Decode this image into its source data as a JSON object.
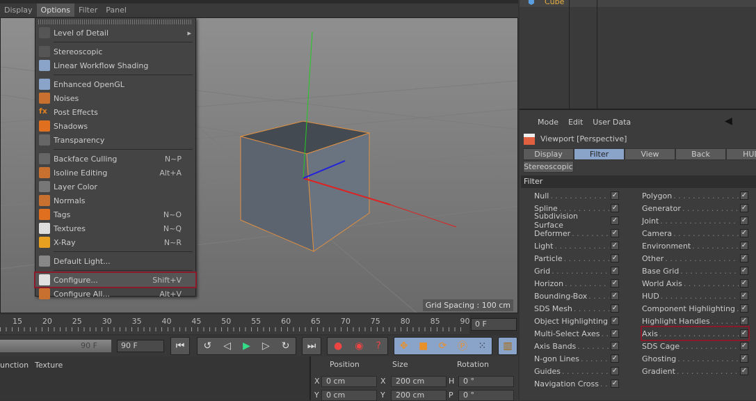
{
  "menubar": [
    "Display",
    "Options",
    "Filter",
    "Panel"
  ],
  "menu": {
    "items": [
      {
        "label": "Level of Detail",
        "submenu": true,
        "icon": "blank",
        "sep_after": true
      },
      {
        "label": "Stereoscopic",
        "icon": "glasses"
      },
      {
        "label": "Linear Workflow Shading",
        "icon": "curve",
        "sep_after": true
      },
      {
        "label": "Enhanced OpenGL",
        "icon": "opengl"
      },
      {
        "label": "Noises",
        "icon": "noise"
      },
      {
        "label": "Post Effects",
        "icon": "fx"
      },
      {
        "label": "Shadows",
        "icon": "shadow"
      },
      {
        "label": "Transparency",
        "icon": "cube",
        "sep_after": true
      },
      {
        "label": "Backface Culling",
        "shortcut": "N~P",
        "icon": "cube"
      },
      {
        "label": "Isoline Editing",
        "shortcut": "Alt+A",
        "icon": "isoline"
      },
      {
        "label": "Layer Color",
        "icon": "layer"
      },
      {
        "label": "Normals",
        "icon": "normals"
      },
      {
        "label": "Tags",
        "shortcut": "N~O",
        "icon": "eye"
      },
      {
        "label": "Textures",
        "shortcut": "N~Q",
        "icon": "checker"
      },
      {
        "label": "X-Ray",
        "shortcut": "N~R",
        "icon": "xray",
        "sep_after": true
      },
      {
        "label": "Default Light...",
        "icon": "light",
        "sep_after": true
      },
      {
        "label": "Configure...",
        "shortcut": "Shift+V",
        "icon": "configure",
        "highlight": true
      },
      {
        "label": "Configure All...",
        "shortcut": "Alt+V",
        "icon": "configure-all"
      }
    ]
  },
  "viewport": {
    "grid_spacing": "Grid Spacing : 100 cm"
  },
  "timeline": {
    "ticks": [
      "15",
      "20",
      "25",
      "30",
      "35",
      "40",
      "45",
      "50",
      "55",
      "60",
      "65",
      "70",
      "75",
      "80",
      "85",
      "90"
    ],
    "current_frame": "0 F",
    "end_frame": "90 F",
    "end_frame_field": "90 F"
  },
  "lower": {
    "tabs": [
      "unction",
      "Texture"
    ],
    "coords": {
      "headers": [
        "Position",
        "Size",
        "Rotation"
      ],
      "rows": [
        [
          "X",
          "0 cm",
          "X",
          "200 cm",
          "H",
          "0 °"
        ],
        [
          "Y",
          "0 cm",
          "Y",
          "200 cm",
          "P",
          "0 °"
        ]
      ]
    }
  },
  "object_manager": {
    "object": "Cube"
  },
  "attributes": {
    "menu": [
      "Mode",
      "Edit",
      "User Data"
    ],
    "title": "Viewport [Perspective]",
    "tabs": [
      "Display",
      "Filter",
      "View",
      "Back",
      "HUD"
    ],
    "active_tab": "Filter",
    "subtab": "Stereoscopic",
    "section": "Filter",
    "left": [
      "Null",
      "Spline",
      "Subdivision Surface",
      "Deformer",
      "Light",
      "Particle",
      "Grid",
      "Horizon",
      "Bounding-Box",
      "SDS Mesh",
      "Object Highlighting",
      "Multi-Select Axes",
      "Axis Bands",
      "N-gon Lines",
      "Guides",
      "Navigation Cross"
    ],
    "right": [
      "Polygon",
      "Generator",
      "Joint",
      "Camera",
      "Environment",
      "Other",
      "Base Grid",
      "World Axis",
      "HUD",
      "Component Highlighting",
      "Highlight Handles",
      "Axis",
      "SDS Cage",
      "Ghosting",
      "Gradient"
    ],
    "highlighted": "Axis"
  },
  "colors": {
    "accent": "#8aa3c9",
    "highlight": "#8a1a2a",
    "selection": "#f0a030"
  }
}
